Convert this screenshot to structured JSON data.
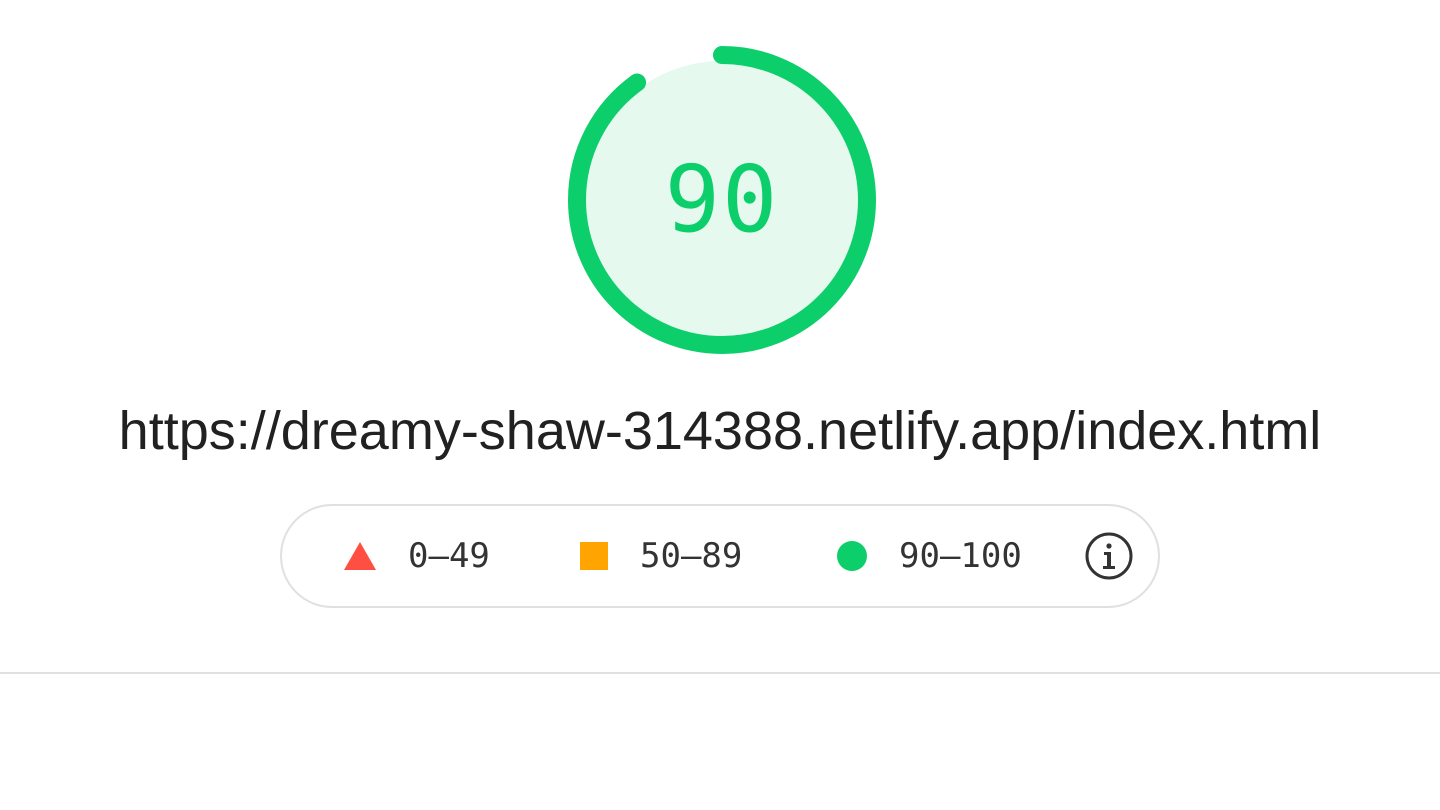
{
  "score": {
    "value": "90",
    "fraction": 0.9,
    "color": "#0cce6b",
    "fill_color": "#e6f9ef"
  },
  "url": "https://dreamy-shaw-314388.netlify.app/index.html",
  "legend": {
    "items": [
      {
        "icon": "triangle-icon",
        "label": "0–49",
        "color": "#ff4e42"
      },
      {
        "icon": "square-icon",
        "label": "50–89",
        "color": "#ffa400"
      },
      {
        "icon": "circle-icon",
        "label": "90–100",
        "color": "#0cce6b"
      }
    ],
    "info_icon": "info-icon"
  }
}
